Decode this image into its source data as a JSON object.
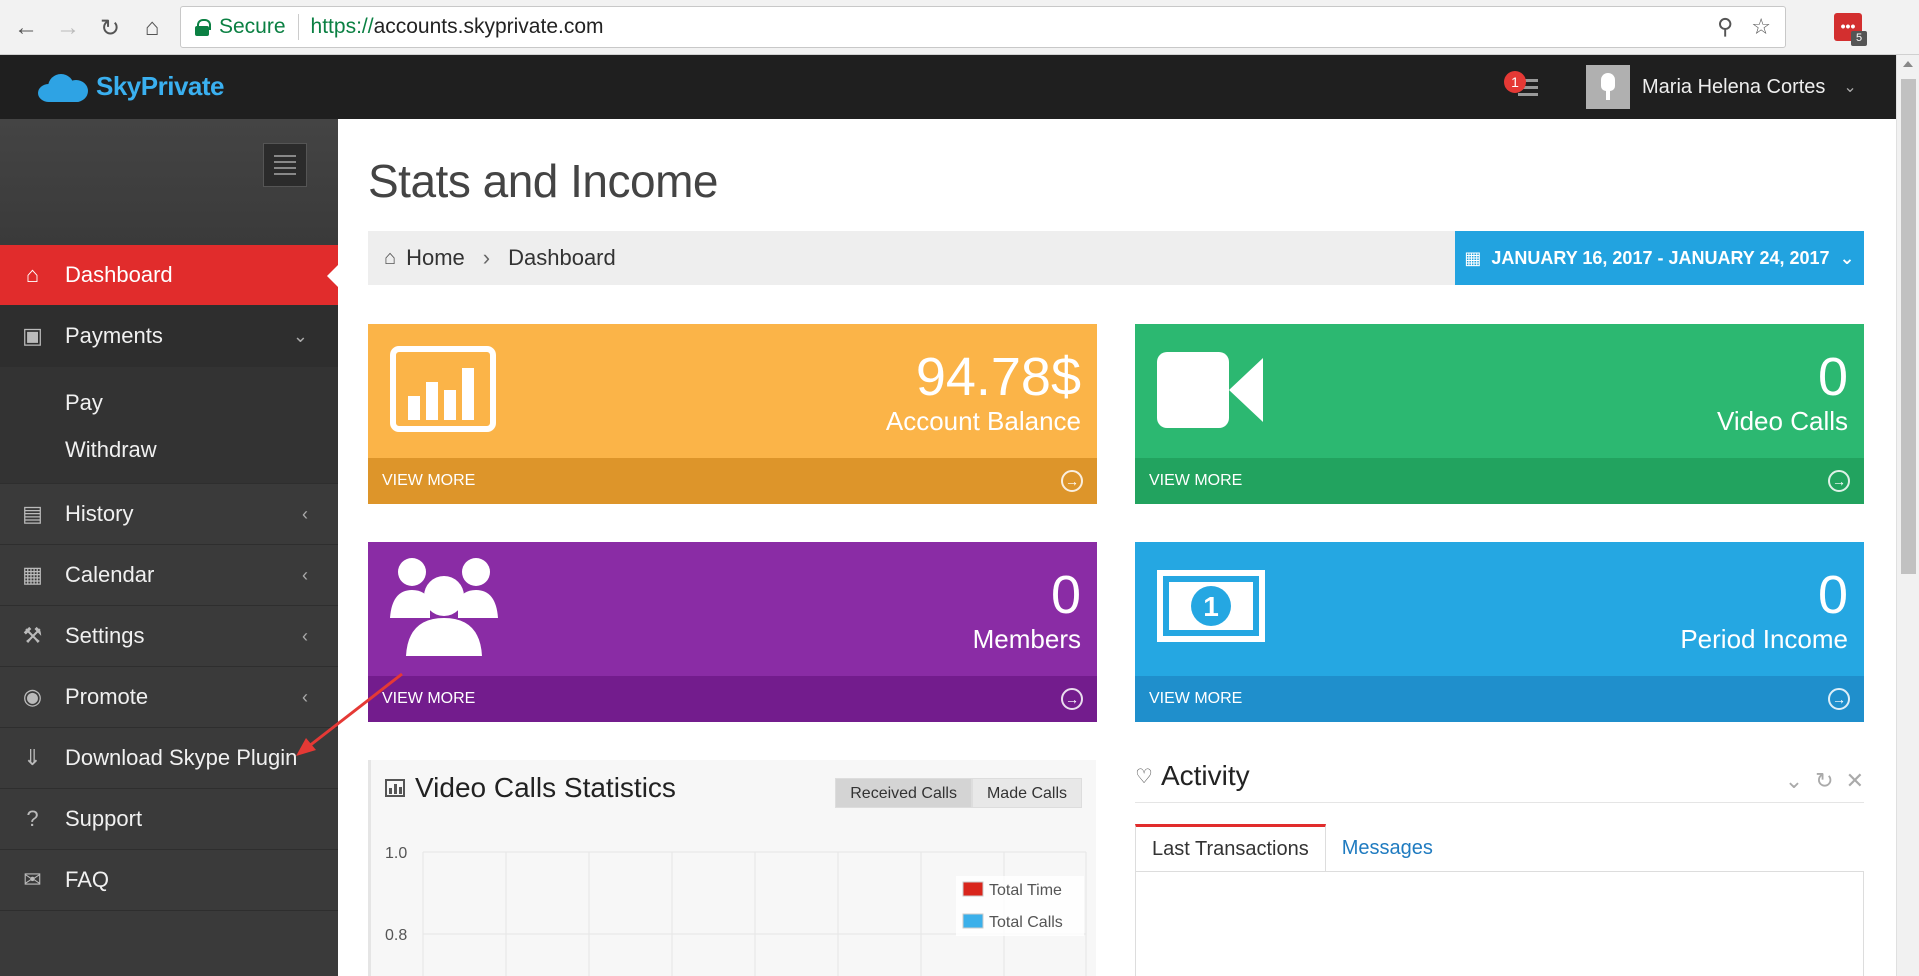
{
  "browser": {
    "secure_label": "Secure",
    "url_scheme": "https://",
    "url_host": "accounts.skyprivate.com",
    "ext_badge": "5"
  },
  "header": {
    "brand": "SkyPrivate",
    "notification_count": "1",
    "user_name": "Maria Helena Cortes"
  },
  "sidebar": {
    "items": [
      {
        "label": "Dashboard",
        "icon": "home-icon"
      },
      {
        "label": "Payments",
        "icon": "money-icon"
      },
      {
        "label": "History",
        "icon": "book-icon"
      },
      {
        "label": "Calendar",
        "icon": "calendar-icon"
      },
      {
        "label": "Settings",
        "icon": "wrench-icon"
      },
      {
        "label": "Promote",
        "icon": "camera-icon"
      },
      {
        "label": "Download Skype Plugin",
        "icon": "download-icon"
      },
      {
        "label": "Support",
        "icon": "question-icon"
      },
      {
        "label": "FAQ",
        "icon": "comments-icon"
      }
    ],
    "payments_sub": [
      "Pay",
      "Withdraw"
    ]
  },
  "main": {
    "title": "Stats and Income",
    "breadcrumb": [
      "Home",
      "Dashboard"
    ],
    "date_range": "JANUARY 16, 2017 - JANUARY 24, 2017",
    "cards": [
      {
        "value": "94.78$",
        "label": "Account Balance",
        "more": "VIEW MORE",
        "color": "#fbb448"
      },
      {
        "value": "0",
        "label": "Video Calls",
        "more": "VIEW MORE",
        "color": "#2cb871"
      },
      {
        "value": "0",
        "label": "Members",
        "more": "VIEW MORE",
        "color": "#8a2ca5"
      },
      {
        "value": "0",
        "label": "Period Income",
        "more": "VIEW MORE",
        "color": "#25a7e2"
      }
    ],
    "video_calls": {
      "title": "Video Calls Statistics",
      "toggle": [
        "Received Calls",
        "Made Calls"
      ],
      "legend": [
        {
          "name": "Total Time",
          "color": "#d9251c"
        },
        {
          "name": "Total Calls",
          "color": "#3bb0ea"
        }
      ],
      "y_ticks": [
        "1.0",
        "0.8"
      ]
    },
    "activity": {
      "title": "Activity",
      "tabs": [
        "Last Transactions",
        "Messages"
      ]
    }
  },
  "colors": {
    "accent_red": "#e12c2c",
    "brand_blue": "#2ea3e4"
  }
}
